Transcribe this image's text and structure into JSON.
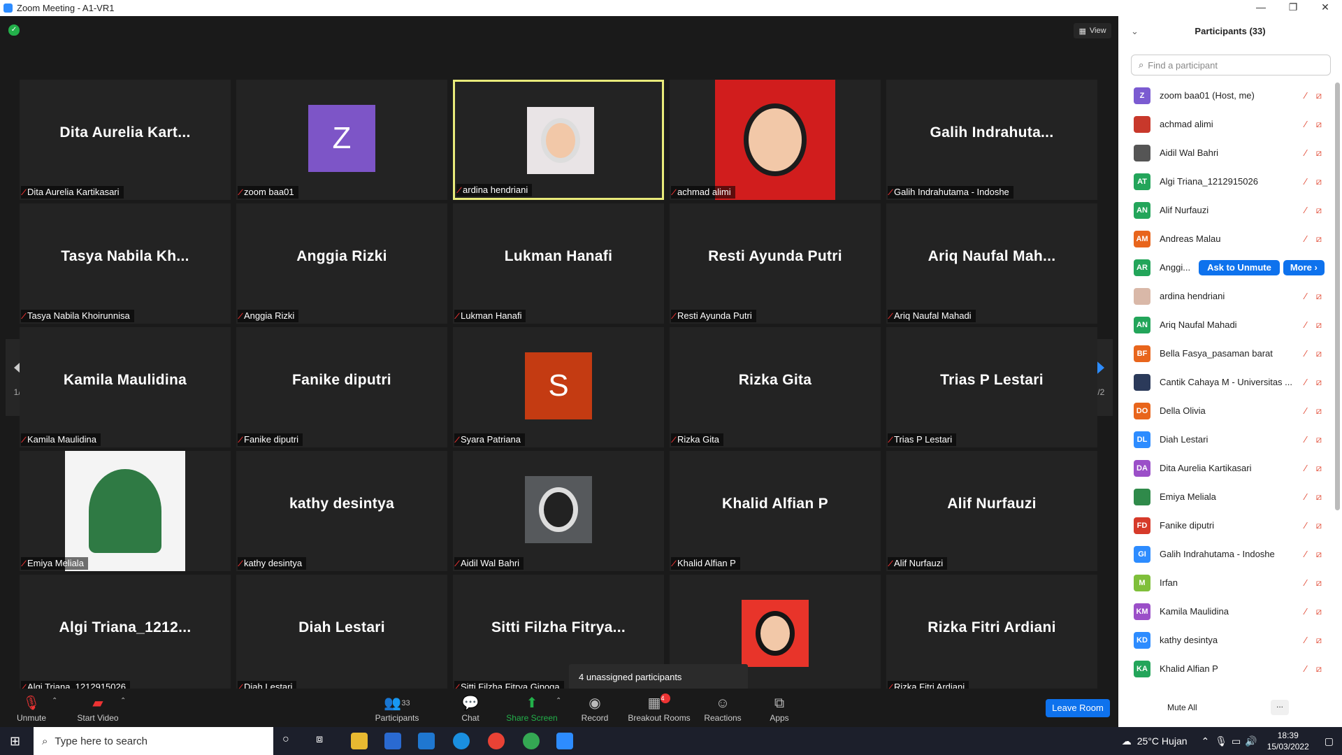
{
  "window": {
    "title": "Zoom Meeting - A1-VR1"
  },
  "view_label": "View",
  "tiles": [
    {
      "big": "Dita  Aurelia  Kart...",
      "label": "Dita Aurelia Kartikasari"
    },
    {
      "avatar_letter": "Z",
      "label": "zoom baa01"
    },
    {
      "label": "ardina hendriani"
    },
    {
      "label": "achmad alimi"
    },
    {
      "big": "Galih  Indrahuta...",
      "label": "Galih Indrahutama - Indoshe"
    },
    {
      "big": "Tasya  Nabila  Kh...",
      "label": "Tasya Nabila Khoirunnisa"
    },
    {
      "big": "Anggia Rizki",
      "label": "Anggia Rizki"
    },
    {
      "big": "Lukman Hanafi",
      "label": "Lukman Hanafi"
    },
    {
      "big": "Resti Ayunda Putri",
      "label": "Resti Ayunda Putri"
    },
    {
      "big": "Ariq  Naufal  Mah...",
      "label": "Ariq Naufal Mahadi"
    },
    {
      "big": "Kamila Maulidina",
      "label": "Kamila Maulidina"
    },
    {
      "big": "Fanike diputri",
      "label": "Fanike diputri"
    },
    {
      "avatar_letter": "S",
      "label": "Syara Patriana"
    },
    {
      "big": "Rizka Gita",
      "label": "Rizka Gita"
    },
    {
      "big": "Trias P Lestari",
      "label": "Trias P Lestari"
    },
    {
      "label": "Emiya Meliala"
    },
    {
      "big": "kathy desintya",
      "label": "kathy desintya"
    },
    {
      "label": "Aidil Wal Bahri"
    },
    {
      "big": "Khalid Alfian P",
      "label": "Khalid Alfian P"
    },
    {
      "big": "Alif Nurfauzi",
      "label": "Alif Nurfauzi"
    },
    {
      "big": "Algi  Triana_1212...",
      "label": "Algi Triana_1212915026"
    },
    {
      "big": "Diah Lestari",
      "label": "Diah Lestari"
    },
    {
      "big": "Sitti  Filzha  Fitrya...",
      "label": "Sitti Filzha Fitrya Ginoga"
    },
    {
      "label": ""
    },
    {
      "big": "Rizka Fitri Ardiani",
      "label": "Rizka Fitri Ardiani"
    }
  ],
  "pager": {
    "left": "1/2",
    "right": "1/2"
  },
  "tooltip": "4 unassigned participants",
  "toolbar": {
    "unmute": "Unmute",
    "start_video": "Start Video",
    "participants": "Participants",
    "participants_count": "33",
    "chat": "Chat",
    "share_screen": "Share Screen",
    "record": "Record",
    "breakout_rooms": "Breakout Rooms",
    "breakout_badge": "4",
    "reactions": "Reactions",
    "apps": "Apps",
    "leave_room": "Leave Room"
  },
  "panel": {
    "title": "Participants (33)",
    "search_placeholder": "Find a participant",
    "ask_to_unmute": "Ask to Unmute",
    "more": "More ›",
    "mute_all": "Mute All",
    "more_dots": "...",
    "participants": [
      {
        "initials": "Z",
        "name": "zoom baa01 (Host, me)",
        "color": "#7b5bd1"
      },
      {
        "initials": "",
        "name": "achmad alimi",
        "color": "#c8382b"
      },
      {
        "initials": "",
        "name": "Aidil Wal Bahri",
        "color": "#555555"
      },
      {
        "initials": "AT",
        "name": "Algi Triana_1212915026",
        "color": "#23a55a"
      },
      {
        "initials": "AN",
        "name": "Alif Nurfauzi",
        "color": "#23a55a"
      },
      {
        "initials": "AM",
        "name": "Andreas Malau",
        "color": "#e8651c"
      },
      {
        "initials": "AR",
        "name": "Anggi...",
        "color": "#23a55a"
      },
      {
        "initials": "",
        "name": "ardina hendriani",
        "color": "#d9b8a8"
      },
      {
        "initials": "AN",
        "name": "Ariq Naufal Mahadi",
        "color": "#23a55a"
      },
      {
        "initials": "BF",
        "name": "Bella Fasya_pasaman barat",
        "color": "#e8651c"
      },
      {
        "initials": "",
        "name": "Cantik Cahaya M - Universitas ...",
        "color": "#2b3a5a"
      },
      {
        "initials": "DO",
        "name": "Della Olivia",
        "color": "#e8651c"
      },
      {
        "initials": "DL",
        "name": "Diah Lestari",
        "color": "#2d8cff"
      },
      {
        "initials": "DA",
        "name": "Dita Aurelia Kartikasari",
        "color": "#9b4fc8"
      },
      {
        "initials": "",
        "name": "Emiya Meliala",
        "color": "#2f8a4a"
      },
      {
        "initials": "FD",
        "name": "Fanike diputri",
        "color": "#d63a2a"
      },
      {
        "initials": "GI",
        "name": "Galih Indrahutama - Indoshe",
        "color": "#2d8cff"
      },
      {
        "initials": "M",
        "name": "Irfan",
        "color": "#7fbf3a"
      },
      {
        "initials": "KM",
        "name": "Kamila Maulidina",
        "color": "#9b4fc8"
      },
      {
        "initials": "KD",
        "name": "kathy desintya",
        "color": "#2d8cff"
      },
      {
        "initials": "KA",
        "name": "Khalid Alfian P",
        "color": "#23a55a"
      }
    ]
  },
  "taskbar": {
    "search_placeholder": "Type here to search",
    "weather": "25°C  Hujan",
    "time": "18:39",
    "date": "15/03/2022"
  },
  "colors": {
    "accent": "#0e72ed",
    "active_speaker": "#e8ea7a",
    "muted_red": "#e0402a",
    "share_green": "#23b04a"
  }
}
